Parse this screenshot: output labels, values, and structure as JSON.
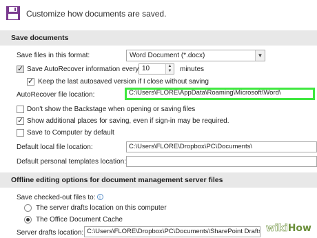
{
  "header": {
    "text": "Customize how documents are saved."
  },
  "save_documents": {
    "title": "Save documents",
    "save_format": {
      "label": "Save files in this format:",
      "value": "Word Document (*.docx)"
    },
    "autorecover": {
      "label": "Save AutoRecover information every",
      "minutes": "10",
      "unit": "minutes",
      "checked": true
    },
    "keep_last": {
      "label": "Keep the last autosaved version if I close without saving",
      "checked": true
    },
    "autorecover_location": {
      "label": "AutoRecover file location:",
      "value": "C:\\Users\\FLORE\\AppData\\Roaming\\Microsoft\\Word\\"
    },
    "dont_show_backstage": {
      "label": "Don't show the Backstage when opening or saving files",
      "checked": false
    },
    "show_additional": {
      "label": "Show additional places for saving, even if sign-in may be required.",
      "checked": true
    },
    "save_to_computer": {
      "label": "Save to Computer by default",
      "checked": false
    },
    "default_local": {
      "label": "Default local file location:",
      "value": "C:\\Users\\FLORE\\Dropbox\\PC\\Documents\\"
    },
    "default_templates": {
      "label": "Default personal templates location:",
      "value": ""
    }
  },
  "offline": {
    "title": "Offline editing options for document management server files",
    "save_checked_out": {
      "label": "Save checked-out files to:"
    },
    "option_server": {
      "label": "The server drafts location on this computer",
      "selected": false
    },
    "option_cache": {
      "label": "The Office Document Cache",
      "selected": true
    },
    "server_drafts": {
      "label": "Server drafts location:",
      "value": "C:\\Users\\FLORE\\Dropbox\\PC\\Documents\\SharePoint Drafts\\"
    }
  },
  "watermark": {
    "part1": "wiki",
    "part2": "How"
  },
  "colors": {
    "highlight": "#3fe83f",
    "section_bg": "#e8e8e8",
    "watermark_green": "#6b8f3a"
  }
}
